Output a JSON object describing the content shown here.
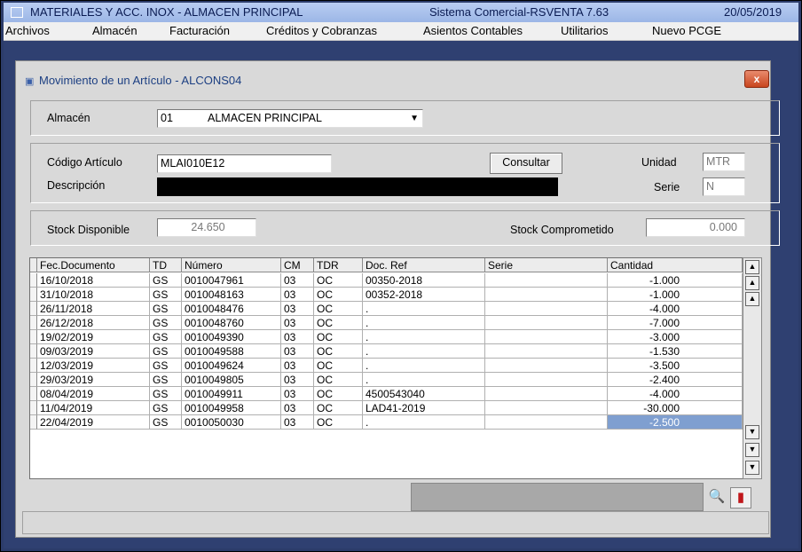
{
  "app": {
    "title": "MATERIALES Y ACC. INOX - ALMACEN PRINCIPAL",
    "system": "Sistema Comercial-RSVENTA 7.63",
    "date": "20/05/2019"
  },
  "menu": [
    "Archivos",
    "Almacén",
    "Facturación",
    "Créditos y Cobranzas",
    "Asientos Contables",
    "Utilitarios",
    "Nuevo PCGE"
  ],
  "window": {
    "title": "Movimiento de un Artículo - ALCONS04",
    "close_label": "x"
  },
  "almacen": {
    "label": "Almacén",
    "code": "01",
    "name": "ALMACEN PRINCIPAL"
  },
  "articulo": {
    "codigo_label": "Código Artículo",
    "codigo_value": "MLAI010E12",
    "descripcion_label": "Descripción",
    "consultar_label": "Consultar",
    "unidad_label": "Unidad",
    "unidad_value": "MTR",
    "serie_label": "Serie",
    "serie_value": "N"
  },
  "stock": {
    "disponible_label": "Stock Disponible",
    "disponible_value": "24.650",
    "comprometido_label": "Stock Comprometido",
    "comprometido_value": "0.000"
  },
  "grid": {
    "columns": [
      "Fec.Documento",
      "TD",
      "Número",
      "CM",
      "TDR",
      "Doc. Ref",
      "Serie",
      "Cantidad"
    ],
    "rows": [
      [
        "16/10/2018",
        "GS",
        "0010047961",
        "03",
        "OC",
        "00350-2018",
        "",
        "-1.000"
      ],
      [
        "31/10/2018",
        "GS",
        "0010048163",
        "03",
        "OC",
        "00352-2018",
        "",
        "-1.000"
      ],
      [
        "26/11/2018",
        "GS",
        "0010048476",
        "03",
        "OC",
        ".",
        "",
        "-4.000"
      ],
      [
        "26/12/2018",
        "GS",
        "0010048760",
        "03",
        "OC",
        ".",
        "",
        "-7.000"
      ],
      [
        "19/02/2019",
        "GS",
        "0010049390",
        "03",
        "OC",
        ".",
        "",
        "-3.000"
      ],
      [
        "09/03/2019",
        "GS",
        "0010049588",
        "03",
        "OC",
        ".",
        "",
        "-1.530"
      ],
      [
        "12/03/2019",
        "GS",
        "0010049624",
        "03",
        "OC",
        ".",
        "",
        "-3.500"
      ],
      [
        "29/03/2019",
        "GS",
        "0010049805",
        "03",
        "OC",
        ".",
        "",
        "-2.400"
      ],
      [
        "08/04/2019",
        "GS",
        "0010049911",
        "03",
        "OC",
        "4500543040",
        "",
        "-4.000"
      ],
      [
        "11/04/2019",
        "GS",
        "0010049958",
        "03",
        "OC",
        "LAD41-2019",
        "",
        "-30.000"
      ],
      [
        "22/04/2019",
        "GS",
        "0010050030",
        "03",
        "OC",
        ".",
        "",
        "-2.500"
      ]
    ],
    "selected_row": 10
  },
  "icons": {
    "binoculars": "binoculars-icon",
    "exit": "exit-door-icon"
  },
  "colors": {
    "title_bar": "#a9c1ec",
    "mdi_background": "#2f4071",
    "selected_cell": "#7f9fd0",
    "close_button": "#d65a35"
  }
}
